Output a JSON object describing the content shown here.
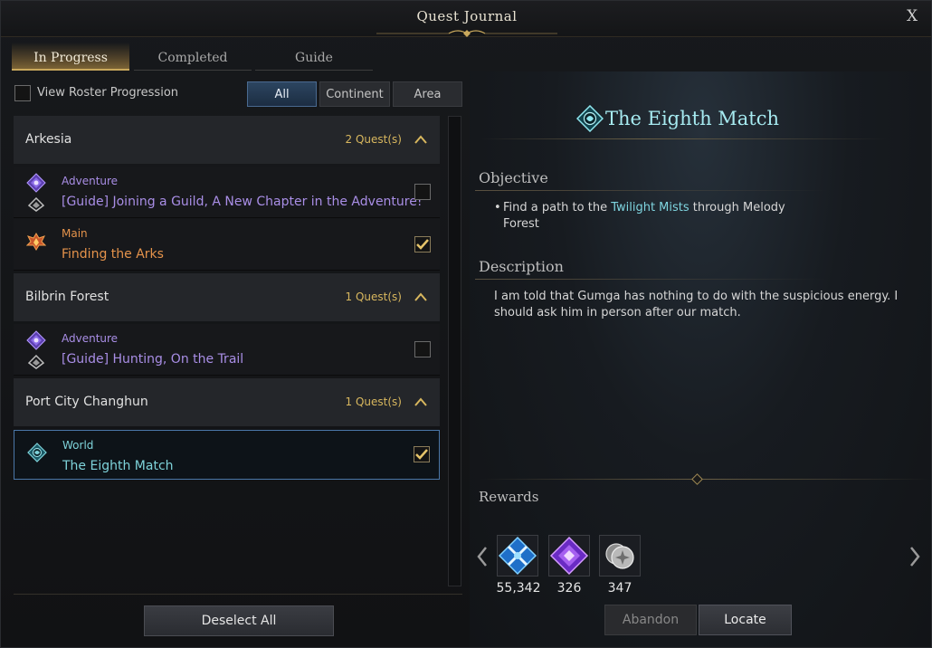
{
  "window": {
    "title": "Quest Journal",
    "close_label": "X"
  },
  "tabs": [
    {
      "label": "In Progress",
      "active": true
    },
    {
      "label": "Completed",
      "active": false
    },
    {
      "label": "Guide",
      "active": false
    }
  ],
  "roster": {
    "label": "View Roster Progression",
    "checked": false
  },
  "filters": [
    {
      "label": "All",
      "active": true
    },
    {
      "label": "Continent",
      "active": false
    },
    {
      "label": "Area",
      "active": false
    }
  ],
  "groups": [
    {
      "name": "Arkesia",
      "count": "2 Quest(s)",
      "quests": [
        {
          "type": "Adventure",
          "name": "[Guide] Joining a Guild, A New Chapter in the Adventure!",
          "checked": false
        },
        {
          "type": "Main",
          "name": "Finding the Arks",
          "checked": true
        }
      ]
    },
    {
      "name": "Bilbrin Forest",
      "count": "1 Quest(s)",
      "quests": [
        {
          "type": "Adventure",
          "name": "[Guide] Hunting, On the Trail",
          "checked": false
        }
      ]
    },
    {
      "name": "Port City Changhun",
      "count": "1 Quest(s)",
      "quests": [
        {
          "type": "World",
          "name": "The Eighth Match",
          "checked": true,
          "selected": true
        }
      ]
    }
  ],
  "deselect_label": "Deselect All",
  "detail": {
    "title": "The Eighth Match",
    "objective_header": "Objective",
    "objective": {
      "before": "Find a path to the ",
      "highlight": "Twilight Mists",
      "after": " through Melody Forest"
    },
    "description_header": "Description",
    "description": "I am told that Gumga has nothing to do with the suspicious energy. I should ask him in person after our match.",
    "rewards_header": "Rewards",
    "rewards": [
      {
        "icon": "blue-crossed-swords-icon",
        "value": "55,342"
      },
      {
        "icon": "purple-diamond-emblem-icon",
        "value": "326"
      },
      {
        "icon": "silver-coins-icon",
        "value": "347"
      }
    ]
  },
  "actions": {
    "abandon": "Abandon",
    "locate": "Locate"
  },
  "colors": {
    "accent_gold": "#c9a85c",
    "adventure": "#a98ee6",
    "main": "#e5934b",
    "world": "#7ed3da",
    "quest_count": "#d8b75e",
    "selection_border": "#4a77a8"
  }
}
